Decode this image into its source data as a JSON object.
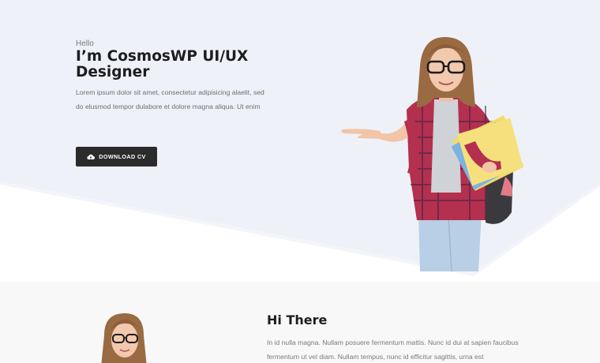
{
  "hero": {
    "greeting": "Hello",
    "title": "I’m CosmosWP UI/UX Designer",
    "description": "Lorem ipsum dolor sit amet, consectetur adipisicing alaelit, sed do elusmod tempor dulabore et dolore magna aliqua. Ut enim",
    "download_button": {
      "label": "DOWNLOAD CV",
      "icon": "cloud-download-icon"
    },
    "image": "woman-with-glasses-holding-books-photo"
  },
  "about": {
    "heading": "Hi There",
    "paragraph": "In id nulla magna. Nullam posuere fermentum mattis. Nunc id dui at sapien faucibus fermentum ut vel diam. Nullam tempus, nunc id efficitur sagittis, urna est",
    "image": "woman-portrait-photo"
  },
  "colors": {
    "hero_background": "#eef1f8",
    "button": "#2b2b2b",
    "section_background": "#f8f8f9"
  }
}
